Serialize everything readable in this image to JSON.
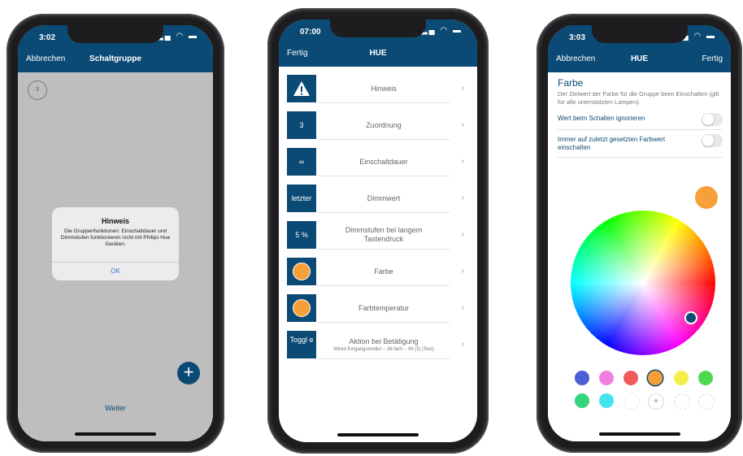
{
  "phone1": {
    "status_time": "3:02",
    "status_icons": "▂▄ ◠ ▬",
    "nav_left": "Abbrechen",
    "nav_title": "Schaltgruppe",
    "step_number": "3",
    "alert": {
      "title": "Hinweis",
      "message": "Die Gruppenfunktionen: Einschaltdauer und Dimmstufen funktionieren nicht mit Philips Hue Geräten.",
      "ok_label": "OK"
    },
    "fab_icon": "plus-icon",
    "weiter_label": "Weiter"
  },
  "phone2": {
    "status_time": "07:00",
    "status_icons": "▂▄ ◠ ▬",
    "nav_left": "Fertig",
    "nav_title": "HUE",
    "rows": [
      {
        "thumb": "warning-icon",
        "label": "Hinweis"
      },
      {
        "thumb": "3",
        "label": "Zuordnung"
      },
      {
        "thumb": "∞",
        "label": "Einschaltdauer"
      },
      {
        "thumb": "letzter",
        "label": "Dimmwert"
      },
      {
        "thumb": "5 %",
        "label": "Dimmstufen bei langem Tastendruck"
      },
      {
        "thumb": "color-dot-icon",
        "label": "Farbe"
      },
      {
        "thumb": "color-dot-icon",
        "label": "Farbtemperatur"
      },
      {
        "thumb": "Toggl e",
        "label": "Aktion bei Betätigung",
        "sub": "Wired Eingangsmodul – 16-fach – IN (3) (Test)"
      }
    ],
    "chevron": "›"
  },
  "phone3": {
    "status_time": "3:03",
    "status_icons": "▂▄ ◠ ▬",
    "nav_left": "Abbrechen",
    "nav_title": "HUE",
    "nav_right": "Fertig",
    "section_title": "Farbe",
    "description": "Der Zielwert der Farbe für die Gruppe beim Einschalten (gilt für alle unterstützten Lampen).",
    "toggle1_label": "Wert beim Schalten ignorieren",
    "toggle2_label": "Immer auf zuletzt gesetzten Farbwert einschalten",
    "toggle1_on": false,
    "toggle2_on": false,
    "selected_color": "#f7a039",
    "swatch_row1": [
      "#4a5fd4",
      "#f07de0",
      "#f05a5a",
      "#f7a039",
      "#f5ee4a",
      "#4fd84f"
    ],
    "swatch_row2": [
      "#35d47e",
      "#46e2f2"
    ],
    "add_swatch": "+"
  },
  "colors": {
    "brand": "#0b4a74",
    "dim_overlay": "#bebebe",
    "link": "#2f7bd6"
  }
}
